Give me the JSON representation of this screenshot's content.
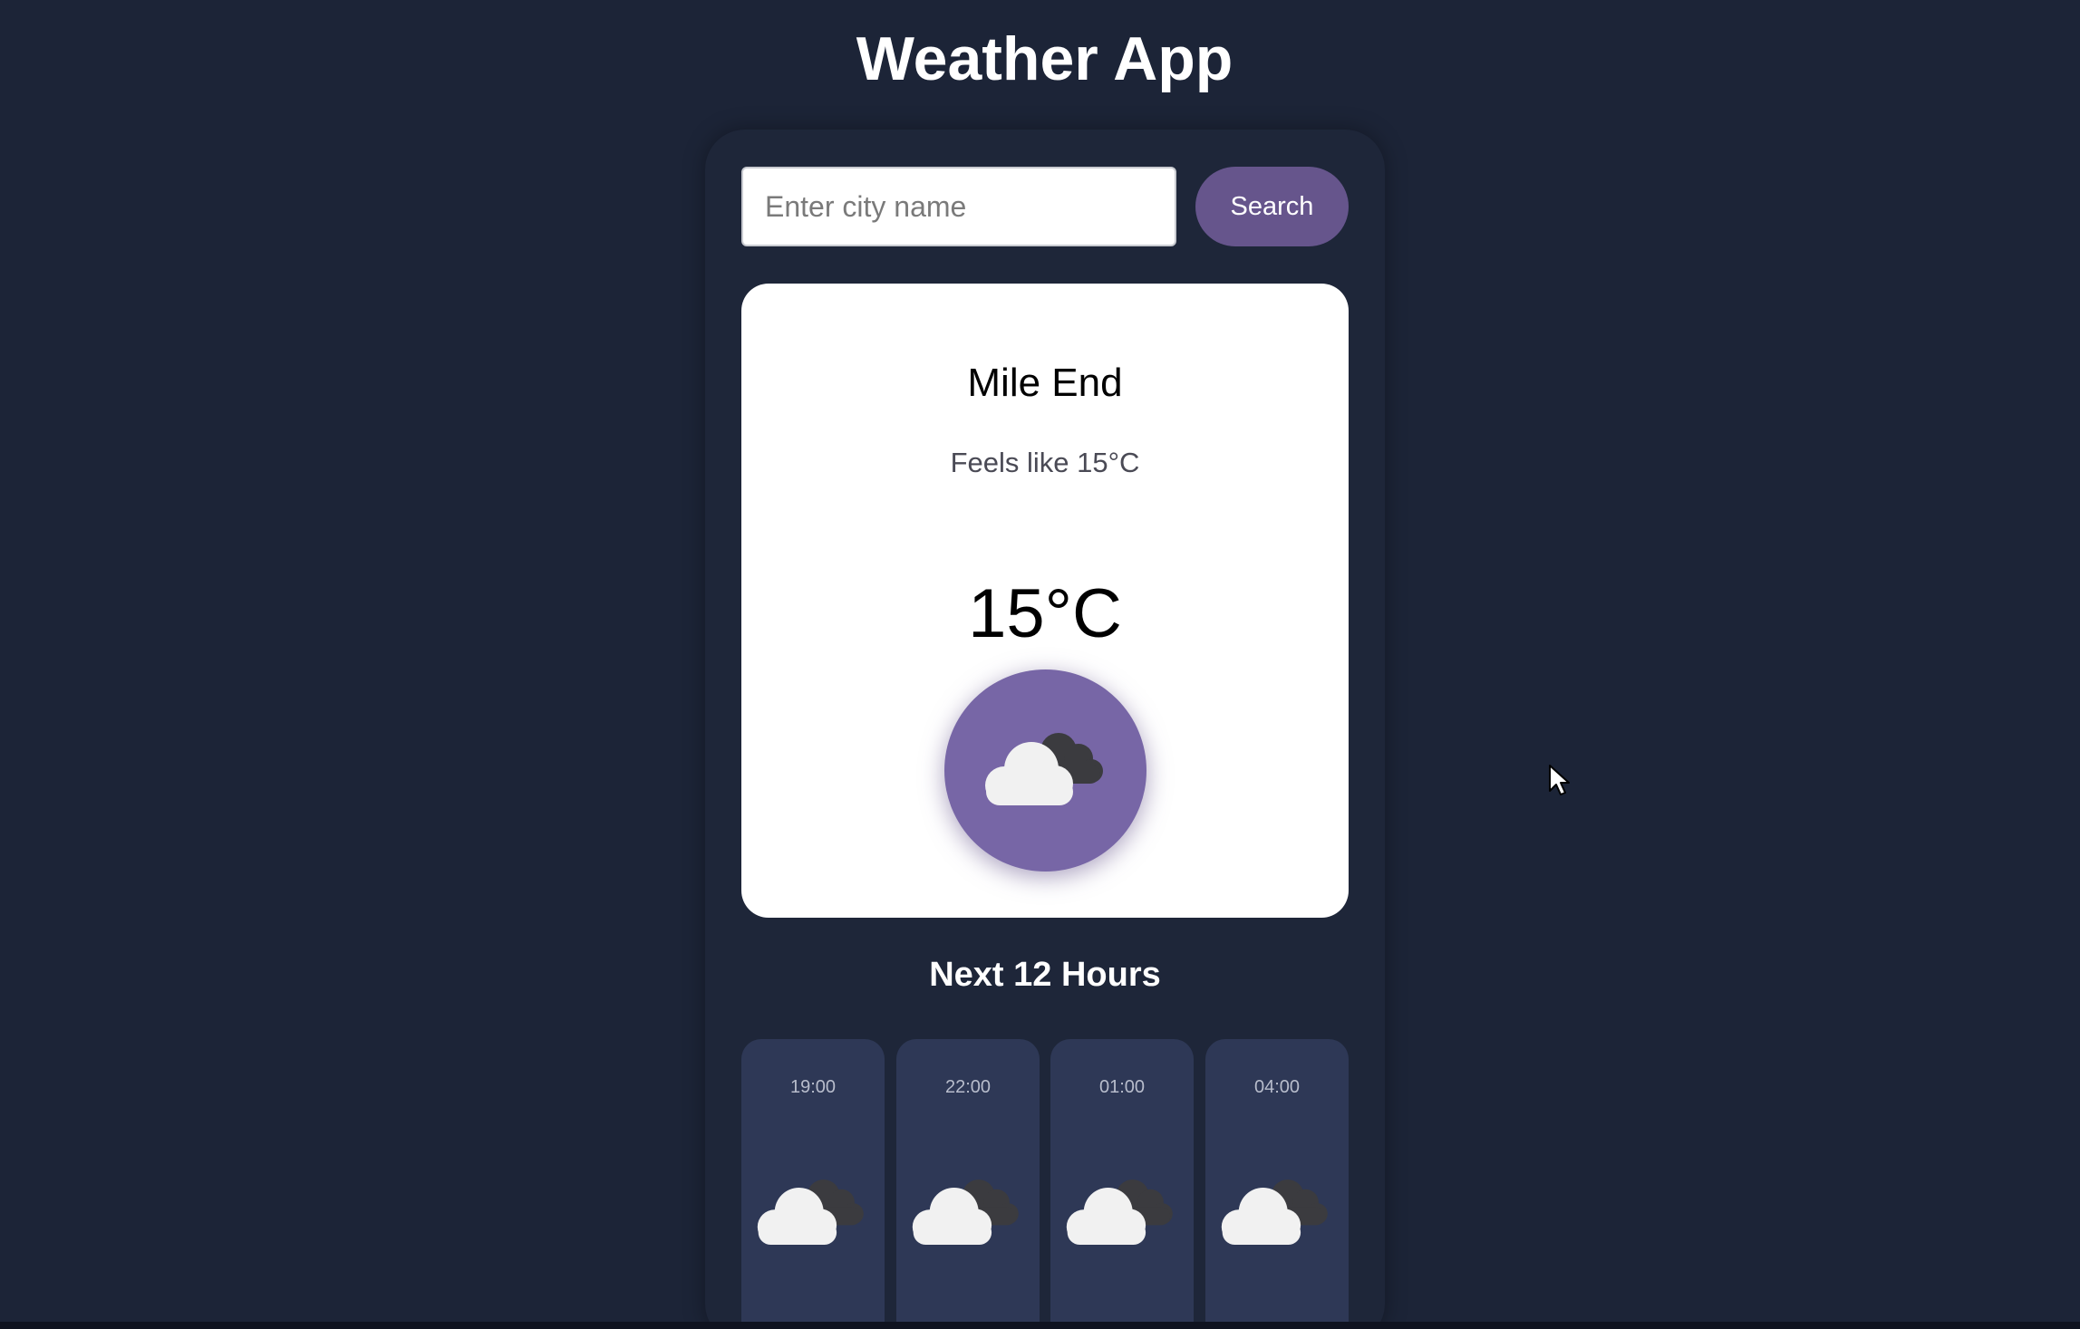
{
  "app": {
    "title": "Weather App"
  },
  "search": {
    "placeholder": "Enter city name",
    "value": "",
    "button_label": "Search"
  },
  "current": {
    "city": "Mile End",
    "feels_like": "Feels like 15°C",
    "temperature": "15°C",
    "icon": "cloudy-icon"
  },
  "forecast": {
    "title": "Next 12 Hours",
    "hours": [
      {
        "time": "19:00",
        "icon": "cloudy-icon"
      },
      {
        "time": "22:00",
        "icon": "cloudy-icon"
      },
      {
        "time": "01:00",
        "icon": "cloudy-icon"
      },
      {
        "time": "04:00",
        "icon": "cloudy-icon"
      }
    ]
  },
  "colors": {
    "background": "#1c2437",
    "accent": "#66558c",
    "icon_circle": "#7766a6",
    "hour_card": "#2e3856",
    "card": "#ffffff"
  }
}
